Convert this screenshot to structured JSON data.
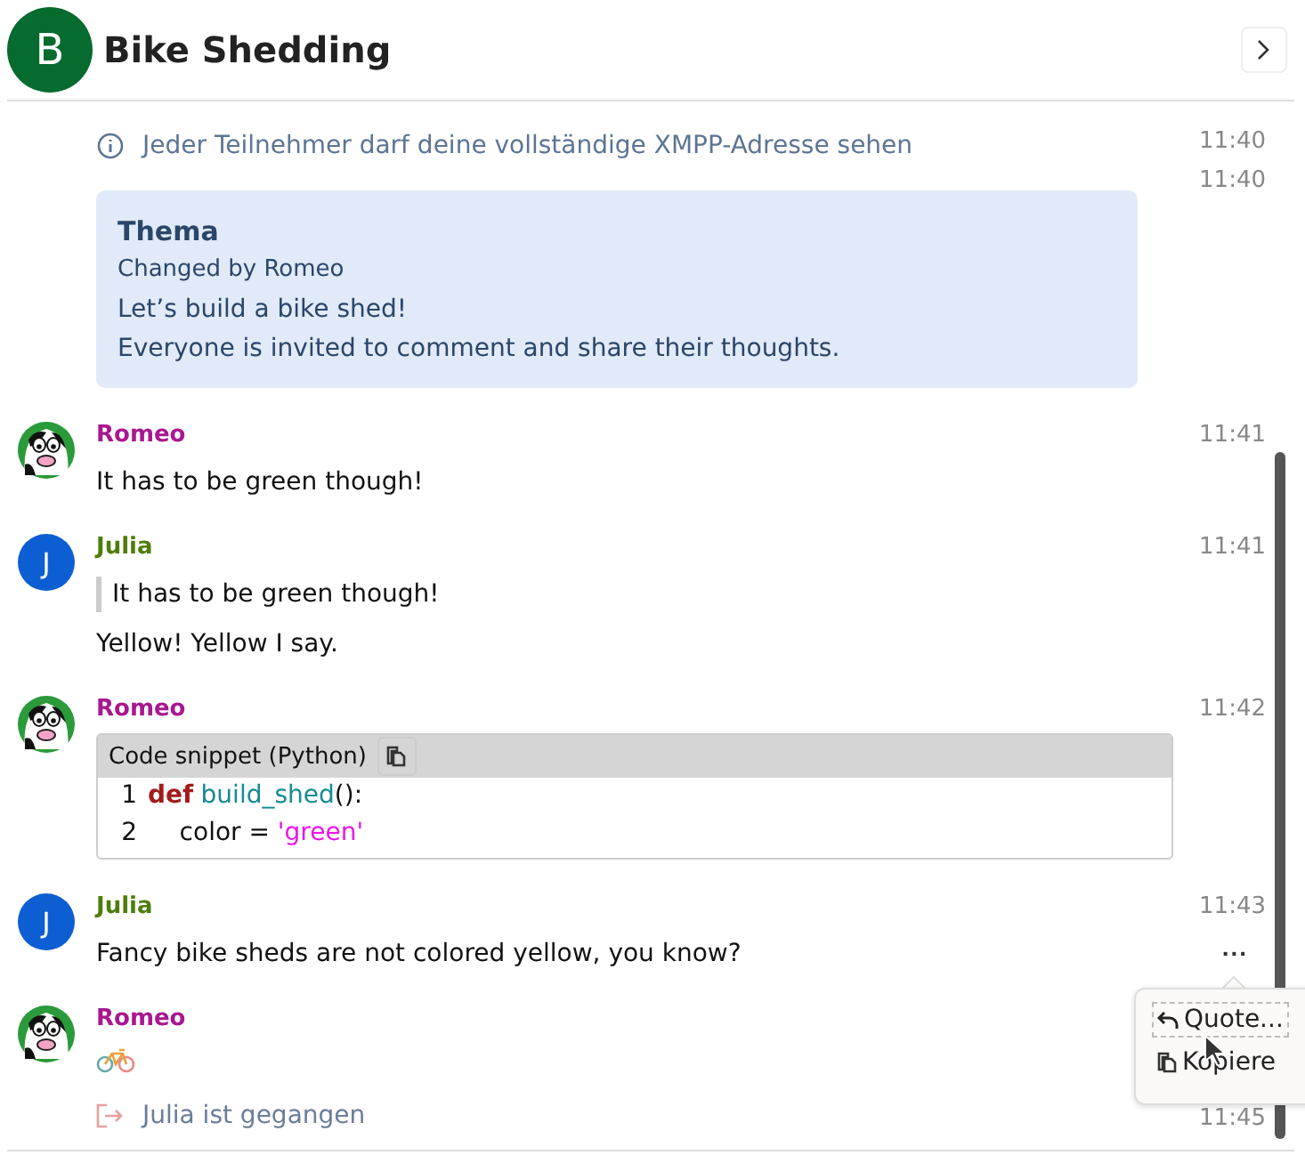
{
  "header": {
    "avatar_letter": "B",
    "title": "Bike Shedding"
  },
  "messages": [
    {
      "kind": "info",
      "text": "Jeder Teilnehmer darf deine vollständige XMPP-Adresse sehen",
      "time": "11:40"
    },
    {
      "kind": "topic",
      "heading": "Thema",
      "byline": "Changed by Romeo",
      "lines": [
        "Let’s build a bike shed!",
        "Everyone is invited to comment and share their thoughts."
      ],
      "time": "11:40"
    },
    {
      "kind": "message",
      "author": "Romeo",
      "color": "#a8188f",
      "avatar": {
        "kind": "cow"
      },
      "time": "11:41",
      "parts": [
        {
          "kind": "text",
          "text": "It has to be green though!"
        }
      ]
    },
    {
      "kind": "message",
      "author": "Julia",
      "color": "#4f7d0d",
      "avatar": {
        "kind": "letter",
        "letter": "J"
      },
      "time": "11:41",
      "parts": [
        {
          "kind": "quote",
          "text": "It has to be green though!"
        },
        {
          "kind": "text",
          "text": "Yellow! Yellow I say."
        }
      ]
    },
    {
      "kind": "message",
      "author": "Romeo",
      "color": "#a8188f",
      "avatar": {
        "kind": "cow"
      },
      "time": "11:42",
      "parts": [
        {
          "kind": "code",
          "title": "Code snippet (Python)",
          "lines": [
            {
              "number": "1",
              "tokens": [
                {
                  "kind": "keyword",
                  "text": "def"
                },
                {
                  "kind": "function",
                  "text": "build_shed"
                },
                {
                  "kind": "plain",
                  "text": "():"
                }
              ]
            },
            {
              "number": "2",
              "tokens": [
                {
                  "kind": "plain",
                  "text": "    color = "
                },
                {
                  "kind": "string",
                  "text": "'green'"
                }
              ]
            }
          ]
        }
      ]
    },
    {
      "kind": "message",
      "author": "Julia",
      "color": "#4f7d0d",
      "avatar": {
        "kind": "letter",
        "letter": "J"
      },
      "time": "11:43",
      "more": "...",
      "parts": [
        {
          "kind": "text",
          "text": "Fancy bike sheds are not colored yellow, you know?"
        }
      ]
    },
    {
      "kind": "message",
      "author": "Romeo",
      "color": "#a8188f",
      "avatar": {
        "kind": "cow"
      },
      "parts": [
        {
          "kind": "bike"
        }
      ]
    },
    {
      "kind": "event",
      "text": "Julia ist gegangen",
      "time": "11:45"
    }
  ],
  "popup": {
    "items": [
      {
        "kind": "quote",
        "label": "Quote...",
        "focused": true
      },
      {
        "kind": "copy",
        "label": "Kopiere",
        "focused": false
      }
    ]
  }
}
